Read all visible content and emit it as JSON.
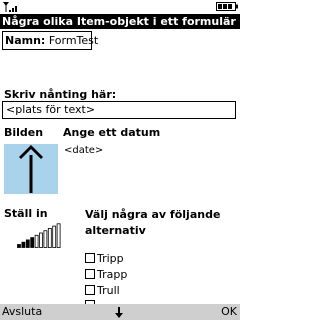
{
  "status": {
    "signal_icon": "signal-strength-icon",
    "battery_icon": "battery-icon"
  },
  "title": "Några olika Item-objekt i ett formulär",
  "name_field": {
    "label": "Namn:",
    "value": "FormTest"
  },
  "text_field": {
    "label": "Skriv nånting här:",
    "value": "<plats för text>"
  },
  "image_item": {
    "label": "Bilden",
    "icon": "up-arrow-icon",
    "background_color": "#a9d3ea"
  },
  "date_field": {
    "label": "Ange ett datum",
    "value": "<date>"
  },
  "gauge": {
    "label": "Ställ in",
    "level": 0.4
  },
  "choice": {
    "label": "Välj några av följande alternativ",
    "options": [
      {
        "label": "Tripp",
        "checked": false
      },
      {
        "label": "Trapp",
        "checked": false
      },
      {
        "label": "Trull",
        "checked": false
      }
    ]
  },
  "softkeys": {
    "left": "Avsluta",
    "right": "OK",
    "center_icon": "down-arrow-icon"
  }
}
